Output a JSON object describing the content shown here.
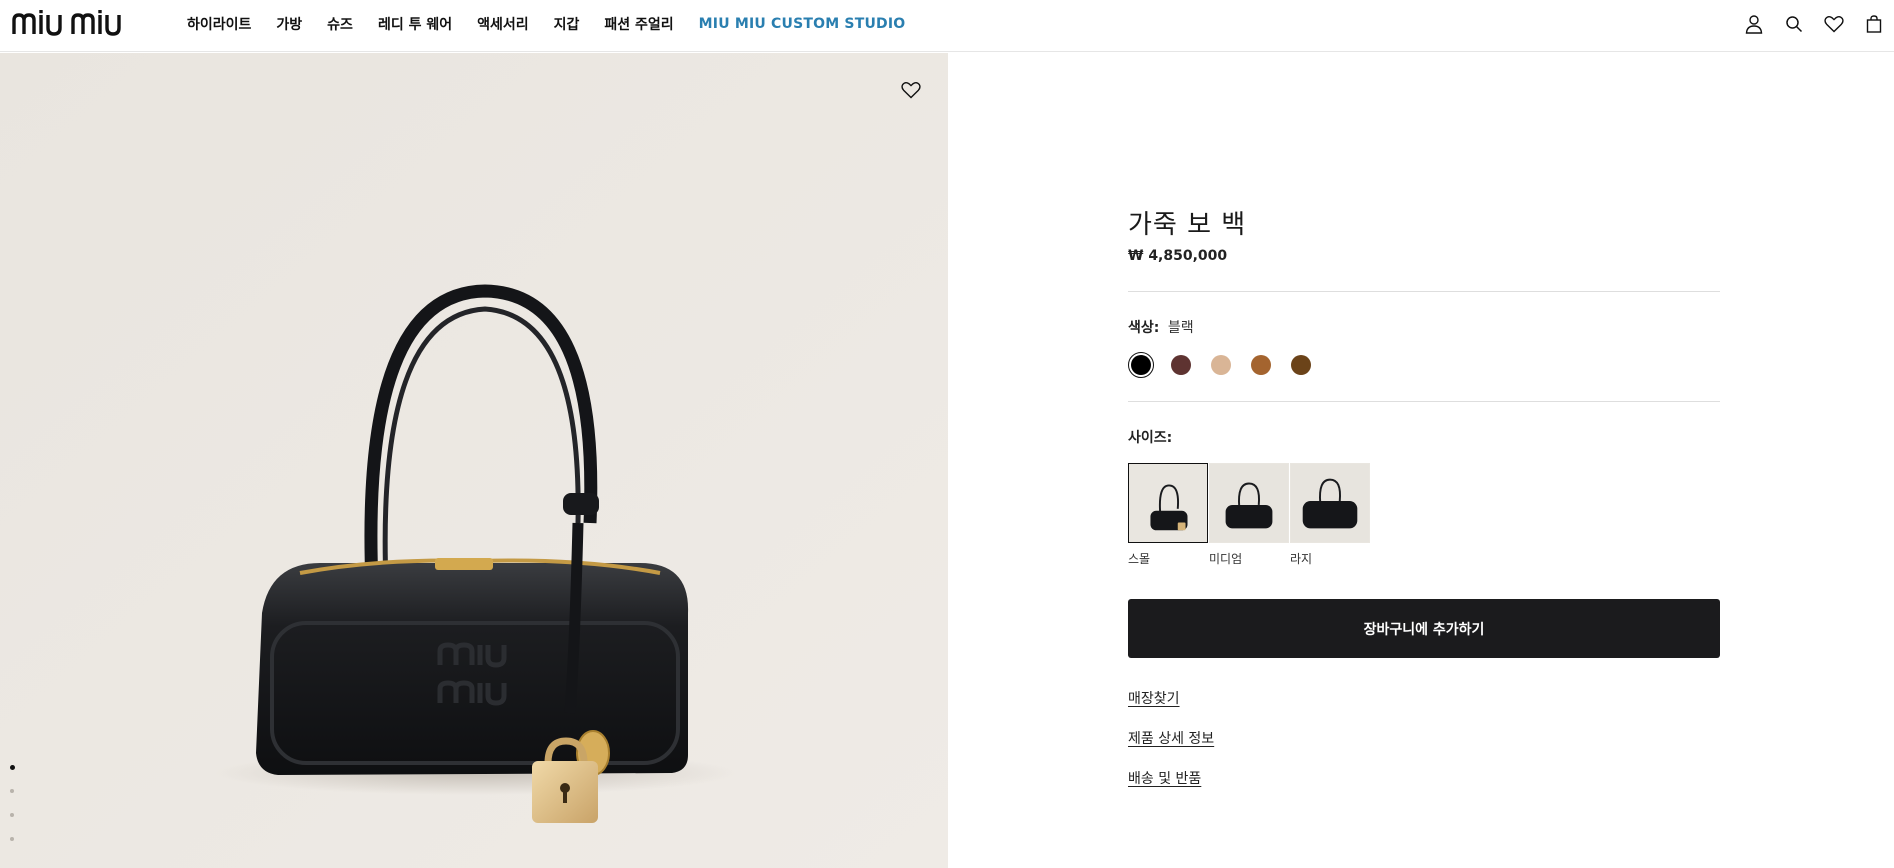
{
  "header": {
    "logo_text": "MIU MIU",
    "nav": [
      "하이라이트",
      "가방",
      "슈즈",
      "레디 투 웨어",
      "액세서리",
      "지갑",
      "패션 주얼리"
    ],
    "nav_accent": "MIU MIU CUSTOM STUDIO",
    "accent_color": "#2a7fb0",
    "icons": [
      "account-icon",
      "search-icon",
      "wishlist-heart-icon",
      "shopping-bag-icon"
    ]
  },
  "gallery": {
    "background_color": "#ece8e2",
    "image_description_icon": "leather-bowling-bag-with-padlock-charm",
    "fav_icon": "heart-icon",
    "slide_count": 4,
    "active_slide": 1
  },
  "product": {
    "title": "가죽 보 백",
    "price": "₩ 4,850,000",
    "color_label": "색상:",
    "color_value": "블랙",
    "colors": [
      {
        "name": "black",
        "hex": "#000000",
        "selected": true
      },
      {
        "name": "burgundy",
        "hex": "#5e3331",
        "selected": false
      },
      {
        "name": "beige",
        "hex": "#d9b596",
        "selected": false
      },
      {
        "name": "cognac",
        "hex": "#a4642f",
        "selected": false
      },
      {
        "name": "brown",
        "hex": "#6b4319",
        "selected": false
      }
    ],
    "size_label": "사이즈:",
    "sizes": [
      {
        "label": "스몰",
        "selected": true
      },
      {
        "label": "미디엄",
        "selected": false
      },
      {
        "label": "라지",
        "selected": false
      }
    ],
    "add_to_cart": "장바구니에 추가하기",
    "links": [
      "매장찾기",
      "제품 상세 정보",
      "배송 및 반품"
    ]
  }
}
